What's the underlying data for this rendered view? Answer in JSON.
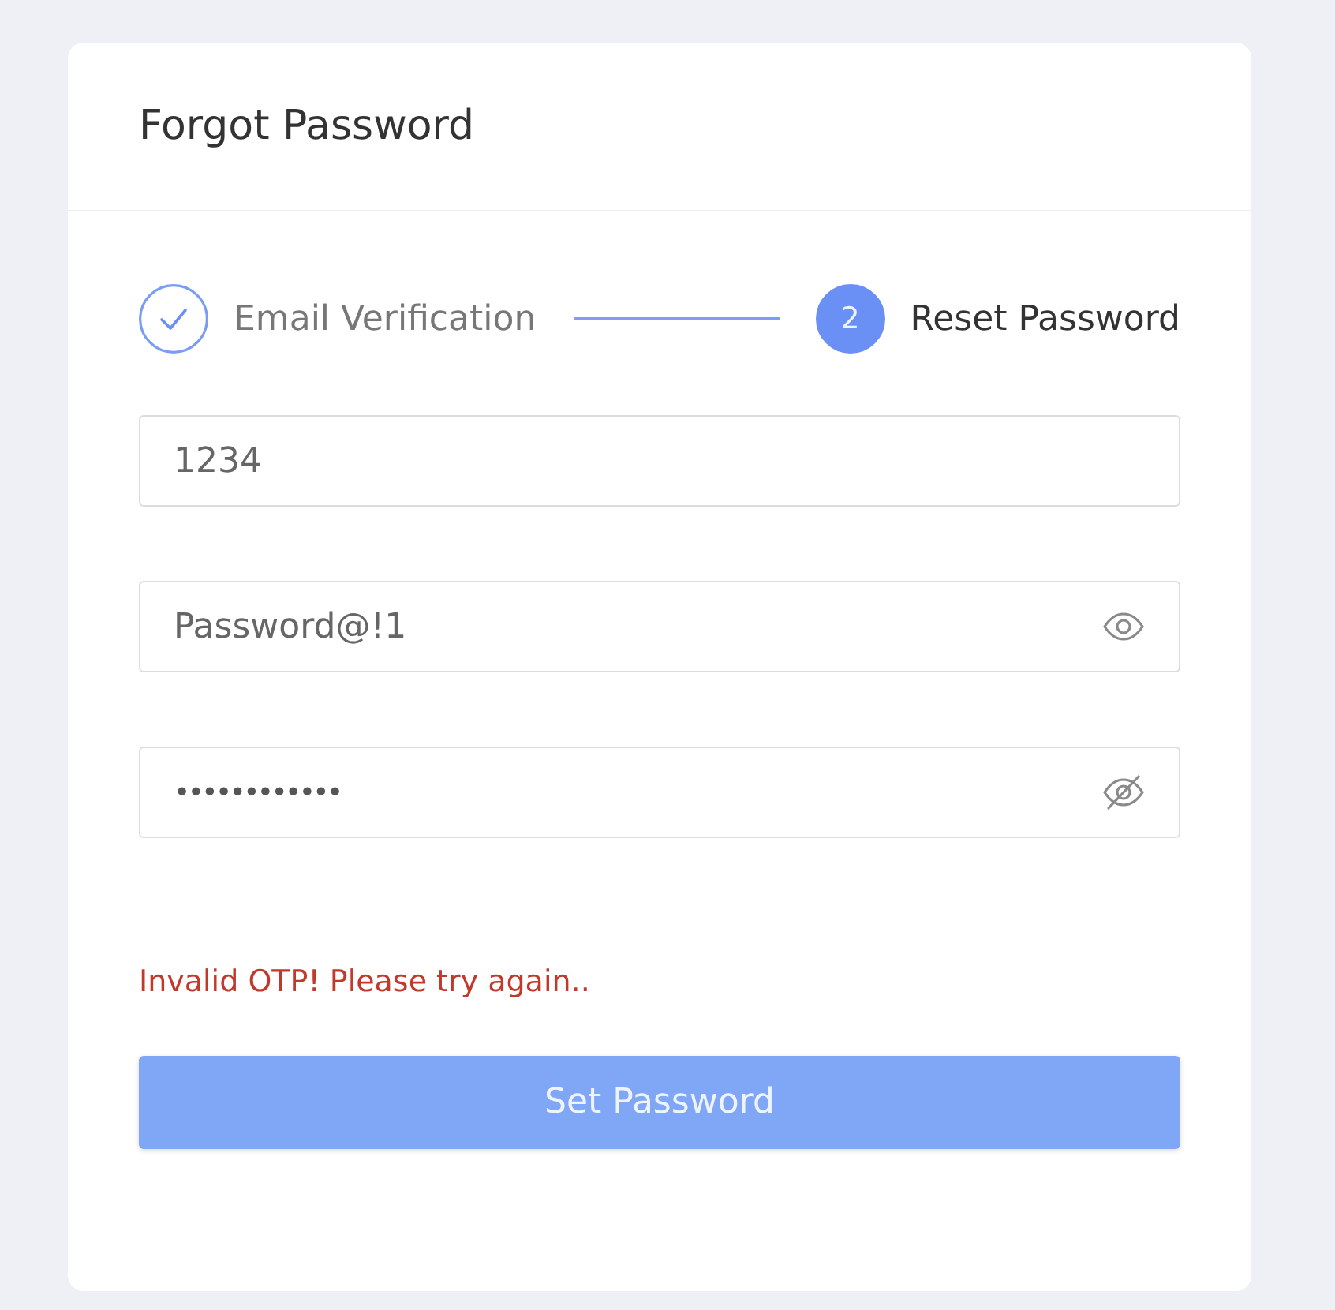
{
  "card": {
    "title": "Forgot Password"
  },
  "steps": [
    {
      "label": "Email Verification",
      "completed": true,
      "selected": false
    },
    {
      "label": "Reset Password",
      "number": "2",
      "completed": false,
      "selected": true
    }
  ],
  "fields": [
    {
      "kind": "text",
      "value": "1234"
    },
    {
      "kind": "password",
      "value": "Password@!1",
      "visible": true
    },
    {
      "kind": "password",
      "value": "••••••••••••",
      "visible": false
    }
  ],
  "error": "Invalid OTP! Please try again..",
  "submit": {
    "label": "Set Password",
    "disabled": true
  }
}
